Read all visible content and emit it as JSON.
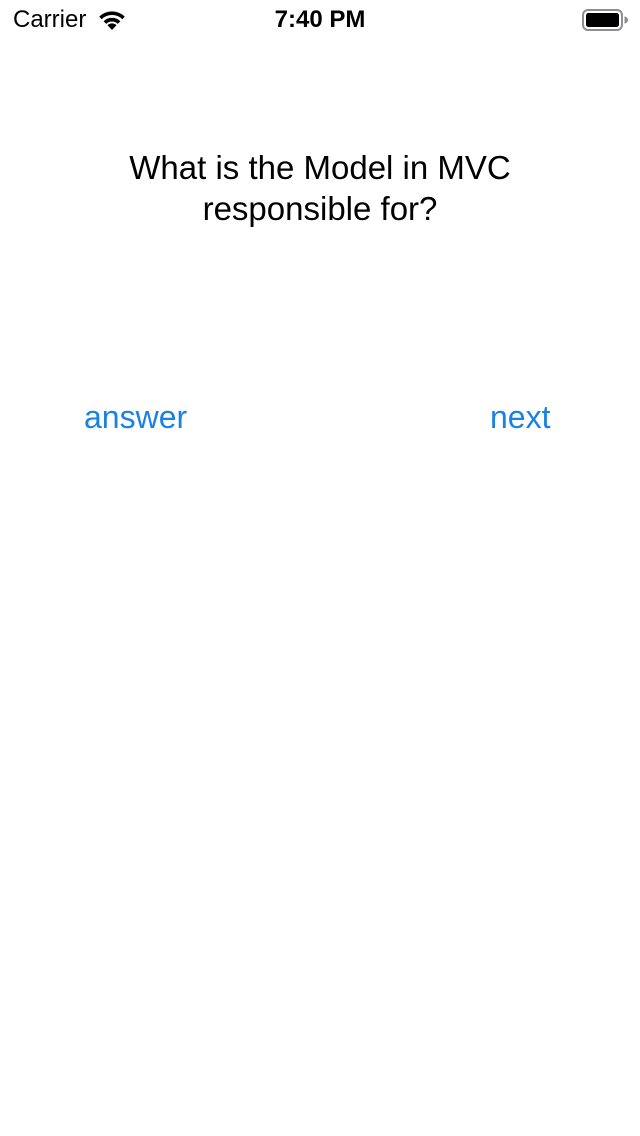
{
  "status_bar": {
    "carrier": "Carrier",
    "time": "7:40 PM",
    "wifi_icon": "wifi-icon",
    "battery_icon": "battery-full-icon"
  },
  "question": {
    "text": "What is the Model in MVC responsible for?"
  },
  "buttons": {
    "answer_label": "answer",
    "next_label": "next"
  },
  "colors": {
    "accent": "#1a82e2",
    "background": "#ffffff",
    "text": "#000000"
  }
}
